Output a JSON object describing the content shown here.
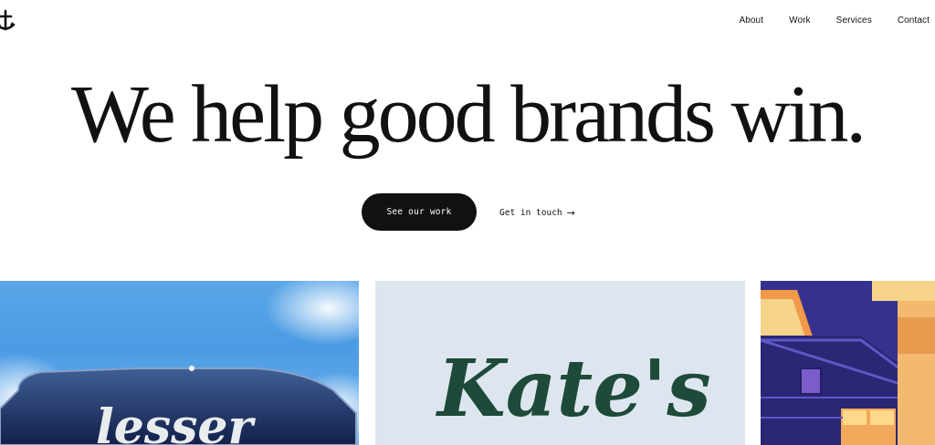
{
  "header": {
    "logo_icon": "anchor-icon",
    "nav": [
      {
        "label": "About"
      },
      {
        "label": "Work"
      },
      {
        "label": "Services"
      },
      {
        "label": "Contact"
      }
    ]
  },
  "hero": {
    "title": "We help good brands win.",
    "primary_cta": "See our work",
    "secondary_cta": "Get in touch",
    "secondary_cta_icon": "arrow-right-icon"
  },
  "gallery": {
    "cards": [
      {
        "image_text": "lesser",
        "theme": "blue sky with dark blue sign"
      },
      {
        "image_text": "Kate's",
        "theme": "pale blue with dark green script"
      },
      {
        "image_text": "",
        "theme": "illustrated purple house with orange windows"
      }
    ]
  },
  "colors": {
    "text": "#111111",
    "button_bg": "#111111",
    "button_text": "#ffffff",
    "background": "#ffffff",
    "kates_green": "#1e4a3a",
    "house_purple": "#36318f",
    "house_orange": "#f29a4a"
  }
}
